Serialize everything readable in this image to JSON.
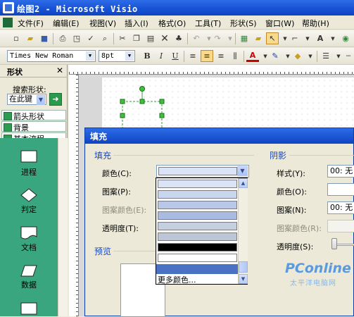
{
  "window": {
    "title": "绘图2 - Microsoft Visio"
  },
  "menu": [
    "文件(F)",
    "编辑(E)",
    "视图(V)",
    "插入(I)",
    "格式(O)",
    "工具(T)",
    "形状(S)",
    "窗口(W)",
    "帮助(H)"
  ],
  "format_toolbar": {
    "font": "Times New Roman",
    "size": "8pt",
    "bold": "B",
    "italic": "I",
    "underline": "U",
    "font_color_letter": "A"
  },
  "shapes_pane": {
    "title": "形状",
    "search_label": "搜索形状:",
    "search_scope": "在此键",
    "stencils": [
      "箭头形状",
      "背景",
      "基本流程..."
    ],
    "shapes": [
      "进程",
      "判定",
      "文档",
      "数据"
    ]
  },
  "fill_dialog": {
    "title": "填充",
    "fill_group": "填充",
    "color_label": "颜色(C):",
    "pattern_label": "图案(P):",
    "pattern_color_label": "图案颜色(E):",
    "transparency_label": "透明度(T):",
    "preview_group": "预览",
    "color_options": [
      "#dbe4f7",
      "#c9d6f0",
      "#b8c8e9",
      "#a8bbe3",
      "#c4cfe0",
      "#bcc6d6",
      "#000000",
      "#ffffff",
      "#4a72c4"
    ],
    "more_colors": "更多颜色...",
    "shadow_group": "阴影",
    "shadow_style_label": "样式(Y):",
    "shadow_style_value": "00: 无",
    "shadow_color_label": "颜色(O):",
    "shadow_pattern_label": "图案(N):",
    "shadow_pattern_value": "00: 无",
    "shadow_pattern_color_label": "图案颜色(R):",
    "shadow_transparency_label": "透明度(S):"
  },
  "watermark": {
    "brand": "PConline",
    "sub": "太平洋电脑网"
  }
}
